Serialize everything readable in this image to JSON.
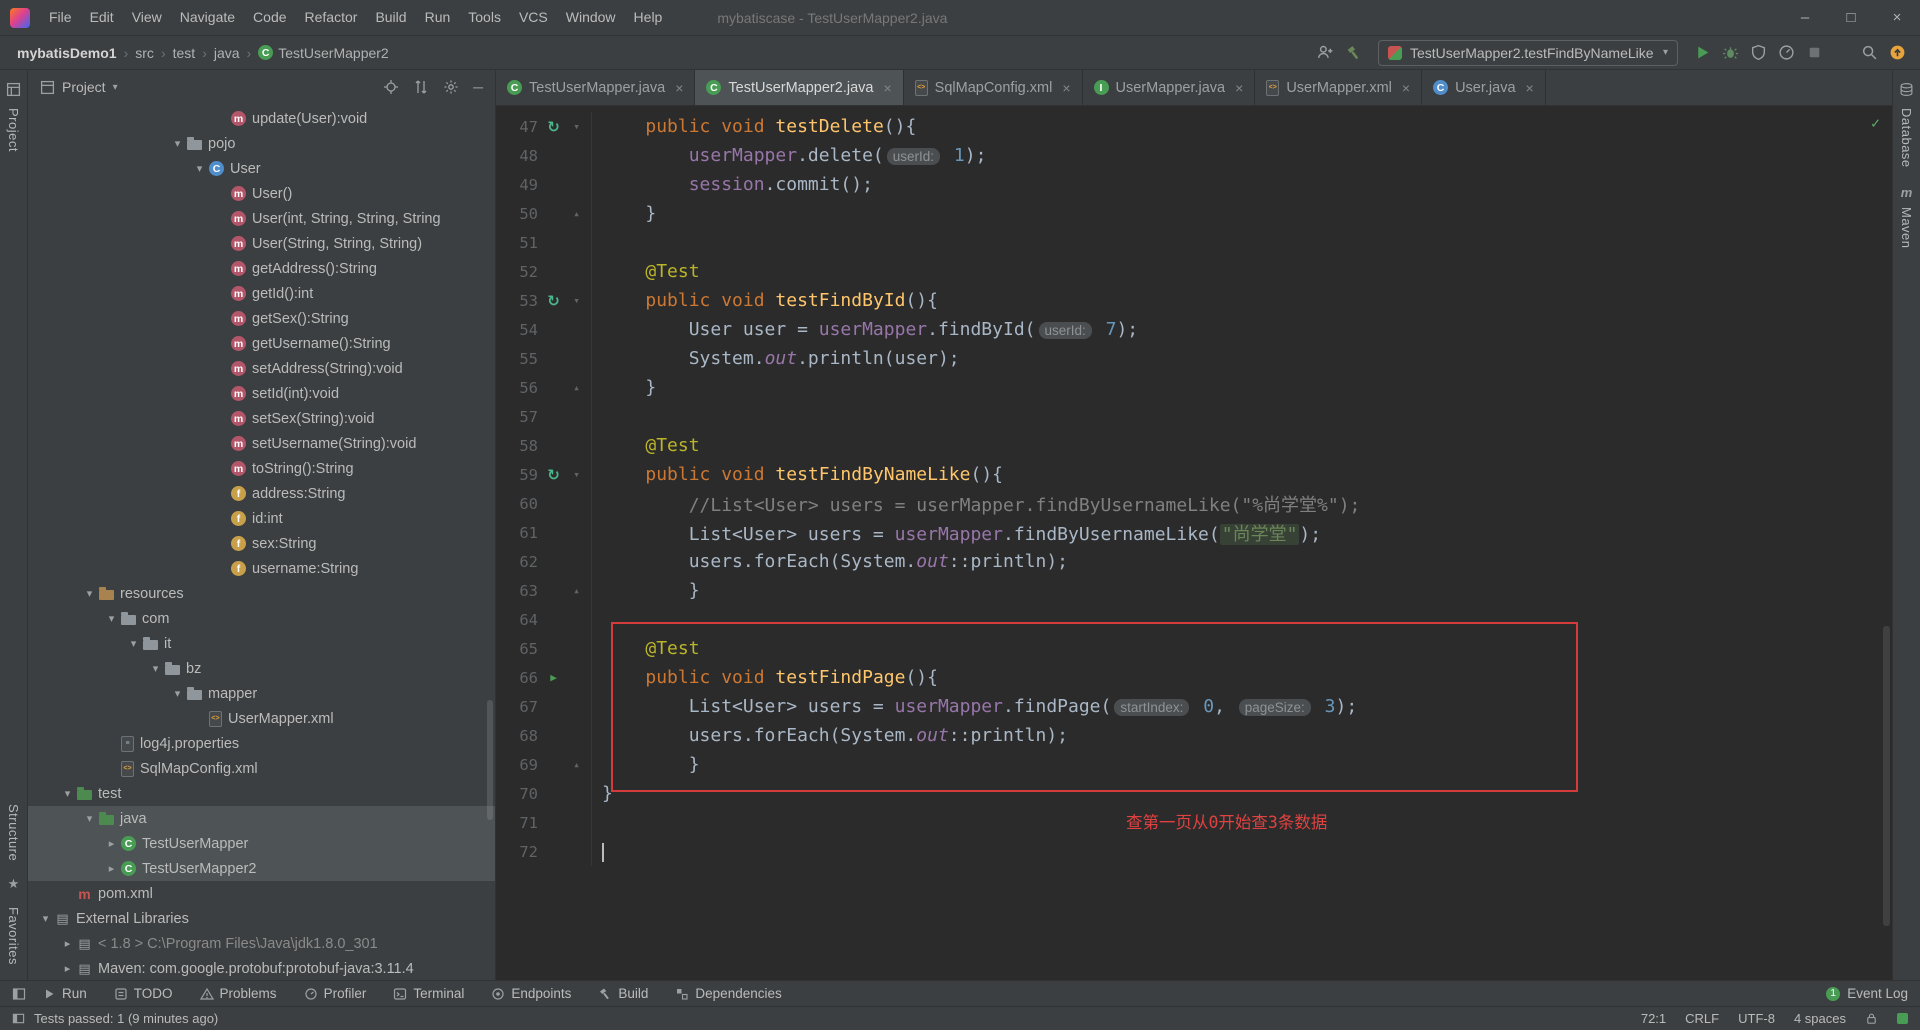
{
  "colors": {
    "editor_bg": "#2b2b2b",
    "panel_bg": "#3c3f41",
    "annotation_red": "#d43c3c",
    "run_green": "#499c54"
  },
  "window": {
    "title": "mybatiscase - TestUserMapper2.java",
    "menus": [
      "File",
      "Edit",
      "View",
      "Navigate",
      "Code",
      "Refactor",
      "Build",
      "Run",
      "Tools",
      "VCS",
      "Window",
      "Help"
    ],
    "controls": {
      "minimize": "–",
      "maximize": "□",
      "close": "×"
    }
  },
  "navbar": {
    "breadcrumbs": [
      "mybatisDemo1",
      "src",
      "test",
      "java",
      "TestUserMapper2"
    ],
    "run_config": "TestUserMapper2.testFindByNameLike"
  },
  "stripes": {
    "left_top": "Project",
    "left_bottom": [
      "Structure",
      "Favorites"
    ],
    "right": [
      "Database",
      "Maven"
    ]
  },
  "project": {
    "header_title": "Project",
    "tree": [
      {
        "label": "update(User):void",
        "icon": "method",
        "depth": 8
      },
      {
        "label": "pojo",
        "icon": "folder",
        "depth": 6,
        "expanded": true
      },
      {
        "label": "User",
        "icon": "class",
        "depth": 7,
        "expanded": true
      },
      {
        "label": "User()",
        "icon": "method",
        "depth": 8
      },
      {
        "label": "User(int, String,​ String, String",
        "icon": "method",
        "depth": 8
      },
      {
        "label": "User(String, String, String)",
        "icon": "method",
        "depth": 8
      },
      {
        "label": "getAddress():String",
        "icon": "method",
        "depth": 8
      },
      {
        "label": "getId():int",
        "icon": "method",
        "depth": 8
      },
      {
        "label": "getSex():String",
        "icon": "method",
        "depth": 8
      },
      {
        "label": "getUsername():String",
        "icon": "method",
        "depth": 8
      },
      {
        "label": "setAddress(String):void",
        "icon": "method",
        "depth": 8
      },
      {
        "label": "setId(int):void",
        "icon": "method",
        "depth": 8
      },
      {
        "label": "setSex(String):void",
        "icon": "method",
        "depth": 8
      },
      {
        "label": "setUsername(String):void",
        "icon": "method",
        "depth": 8
      },
      {
        "label": "toString():String",
        "icon": "method",
        "depth": 8
      },
      {
        "label": "address:String",
        "icon": "field",
        "depth": 8
      },
      {
        "label": "id:int",
        "icon": "field",
        "depth": 8
      },
      {
        "label": "sex:String",
        "icon": "field",
        "depth": 8
      },
      {
        "label": "username:String",
        "icon": "field",
        "depth": 8
      },
      {
        "label": "resources",
        "icon": "folder-resources",
        "depth": 2,
        "expanded": true
      },
      {
        "label": "com",
        "icon": "folder",
        "depth": 3,
        "expanded": true
      },
      {
        "label": "it",
        "icon": "folder",
        "depth": 4,
        "expanded": true
      },
      {
        "label": "bz",
        "icon": "folder",
        "depth": 5,
        "expanded": true
      },
      {
        "label": "mapper",
        "icon": "folder",
        "depth": 6,
        "expanded": true
      },
      {
        "label": "UserMapper.xml",
        "icon": "xml",
        "depth": 7
      },
      {
        "label": "log4j.properties",
        "icon": "properties",
        "depth": 3
      },
      {
        "label": "SqlMapConfig.xml",
        "icon": "xml",
        "depth": 3
      },
      {
        "label": "test",
        "icon": "folder-test",
        "depth": 1,
        "expanded": true
      },
      {
        "label": "java",
        "icon": "folder-test",
        "depth": 2,
        "expanded": true,
        "selected": true
      },
      {
        "label": "TestUserMapper",
        "icon": "test-class",
        "depth": 3,
        "collapsed": true,
        "selected": true
      },
      {
        "label": "TestUserMapper2",
        "icon": "test-class",
        "depth": 3,
        "collapsed": true,
        "selected": true
      },
      {
        "label": "pom.xml",
        "icon": "maven",
        "depth": 1
      },
      {
        "label": "External Libraries",
        "icon": "lib",
        "depth": 0,
        "expanded": true
      },
      {
        "label": "< 1.8 > C:\\Program Files\\Java\\jdk1.8.0_301",
        "icon": "jdk",
        "depth": 1,
        "collapsed": true,
        "dim": true
      },
      {
        "label": "Maven: com.google.protobuf:protobuf-java:3.11.4",
        "icon": "lib",
        "depth": 1,
        "collapsed": true
      }
    ]
  },
  "editor": {
    "tabs": [
      {
        "label": "TestUserMapper.java",
        "icon": "test-class",
        "active": false
      },
      {
        "label": "TestUserMapper2.java",
        "icon": "test-class",
        "active": true
      },
      {
        "label": "SqlMapConfig.xml",
        "icon": "xml",
        "active": false
      },
      {
        "label": "UserMapper.java",
        "icon": "interface",
        "active": false
      },
      {
        "label": "UserMapper.xml",
        "icon": "xml",
        "active": false
      },
      {
        "label": "User.java",
        "icon": "class",
        "active": false
      }
    ],
    "note": "查第一页从0开始查3条数据",
    "code": [
      {
        "n": 47,
        "g1": "rerun",
        "g2": "fold-down",
        "s": [
          [
            "    ",
            "p"
          ],
          [
            "public ",
            "k"
          ],
          [
            "void ",
            "k"
          ],
          [
            "testDelete",
            "f"
          ],
          [
            "(){",
            "p"
          ]
        ]
      },
      {
        "n": 48,
        "s": [
          [
            "        ",
            "p"
          ],
          [
            "userMapper",
            "v"
          ],
          [
            ".delete(",
            "p"
          ],
          [
            "userId:",
            "h"
          ],
          [
            " ",
            "p"
          ],
          [
            "1",
            "n"
          ],
          [
            ");",
            "p"
          ]
        ]
      },
      {
        "n": 49,
        "s": [
          [
            "        ",
            "p"
          ],
          [
            "session",
            "v"
          ],
          [
            ".commit();",
            "p"
          ]
        ]
      },
      {
        "n": 50,
        "g2": "fold-up",
        "s": [
          [
            "    }",
            "p"
          ]
        ]
      },
      {
        "n": 51,
        "s": []
      },
      {
        "n": 52,
        "s": [
          [
            "    ",
            "p"
          ],
          [
            "@Test",
            "a"
          ]
        ]
      },
      {
        "n": 53,
        "g1": "rerun",
        "g2": "fold-down",
        "s": [
          [
            "    ",
            "p"
          ],
          [
            "public ",
            "k"
          ],
          [
            "void ",
            "k"
          ],
          [
            "testFindById",
            "f"
          ],
          [
            "(){",
            "p"
          ]
        ]
      },
      {
        "n": 54,
        "s": [
          [
            "        User user = ",
            "p"
          ],
          [
            "userMapper",
            "v"
          ],
          [
            ".findById(",
            "p"
          ],
          [
            "userId:",
            "h"
          ],
          [
            " ",
            "p"
          ],
          [
            "7",
            "n"
          ],
          [
            ");",
            "p"
          ]
        ]
      },
      {
        "n": 55,
        "s": [
          [
            "        System.",
            "p"
          ],
          [
            "out",
            "t"
          ],
          [
            ".println(user);",
            "p"
          ]
        ]
      },
      {
        "n": 56,
        "g2": "fold-up",
        "s": [
          [
            "    }",
            "p"
          ]
        ]
      },
      {
        "n": 57,
        "s": []
      },
      {
        "n": 58,
        "s": [
          [
            "    ",
            "p"
          ],
          [
            "@Test",
            "a"
          ]
        ]
      },
      {
        "n": 59,
        "g1": "rerun",
        "g2": "fold-down",
        "s": [
          [
            "    ",
            "p"
          ],
          [
            "public ",
            "k"
          ],
          [
            "void ",
            "k"
          ],
          [
            "testFindByNameLike",
            "f"
          ],
          [
            "(){",
            "p"
          ]
        ]
      },
      {
        "n": 60,
        "s": [
          [
            "        //List<User> users = userMapper.findByUsernameLike(\"%尚学堂%\");",
            "c"
          ]
        ]
      },
      {
        "n": 61,
        "s": [
          [
            "        List<User> users = ",
            "p"
          ],
          [
            "userMapper",
            "v"
          ],
          [
            ".findByUsernameLike(",
            "p"
          ],
          [
            "\"尚学堂\"",
            "g"
          ],
          [
            ");",
            "p"
          ]
        ]
      },
      {
        "n": 62,
        "s": [
          [
            "        users.forEach(System.",
            "p"
          ],
          [
            "out",
            "t"
          ],
          [
            "::println);",
            "p"
          ]
        ]
      },
      {
        "n": 63,
        "g2": "fold-up",
        "s": [
          [
            "        }",
            "p"
          ]
        ]
      },
      {
        "n": 64,
        "s": []
      },
      {
        "n": 65,
        "s": [
          [
            "    ",
            "p"
          ],
          [
            "@Test",
            "a"
          ]
        ]
      },
      {
        "n": 66,
        "g1": "play",
        "s": [
          [
            "    ",
            "p"
          ],
          [
            "public ",
            "k"
          ],
          [
            "void ",
            "k"
          ],
          [
            "testFindPage",
            "f"
          ],
          [
            "(){",
            "p"
          ]
        ]
      },
      {
        "n": 67,
        "s": [
          [
            "        List<User> users = ",
            "p"
          ],
          [
            "userMapper",
            "v"
          ],
          [
            ".findPage(",
            "p"
          ],
          [
            "startIndex:",
            "h"
          ],
          [
            " ",
            "p"
          ],
          [
            "0",
            "n"
          ],
          [
            ", ",
            "p"
          ],
          [
            "pageSize:",
            "h"
          ],
          [
            " ",
            "p"
          ],
          [
            "3",
            "n"
          ],
          [
            ");",
            "p"
          ]
        ]
      },
      {
        "n": 68,
        "s": [
          [
            "        users.forEach(System.",
            "p"
          ],
          [
            "out",
            "t"
          ],
          [
            "::println);",
            "p"
          ]
        ]
      },
      {
        "n": 69,
        "g2": "fold-up",
        "s": [
          [
            "        }",
            "p"
          ]
        ]
      },
      {
        "n": 70,
        "s": [
          [
            "}",
            "p"
          ]
        ]
      },
      {
        "n": 71,
        "s": []
      },
      {
        "n": 72,
        "s": []
      }
    ]
  },
  "bottom_bar": {
    "items": [
      {
        "icon": "run",
        "label": "Run"
      },
      {
        "icon": "todo",
        "label": "TODO"
      },
      {
        "icon": "problems",
        "label": "Problems"
      },
      {
        "icon": "profiler",
        "label": "Profiler"
      },
      {
        "icon": "terminal",
        "label": "Terminal"
      },
      {
        "icon": "endpoints",
        "label": "Endpoints"
      },
      {
        "icon": "build",
        "label": "Build"
      },
      {
        "icon": "dependencies",
        "label": "Dependencies"
      }
    ],
    "event_log": {
      "label": "Event Log",
      "badge": "1"
    }
  },
  "status_bar": {
    "message": "Tests passed: 1 (9 minutes ago)",
    "caret": "72:1",
    "line_sep": "CRLF",
    "encoding": "UTF-8",
    "indent": "4 spaces"
  }
}
